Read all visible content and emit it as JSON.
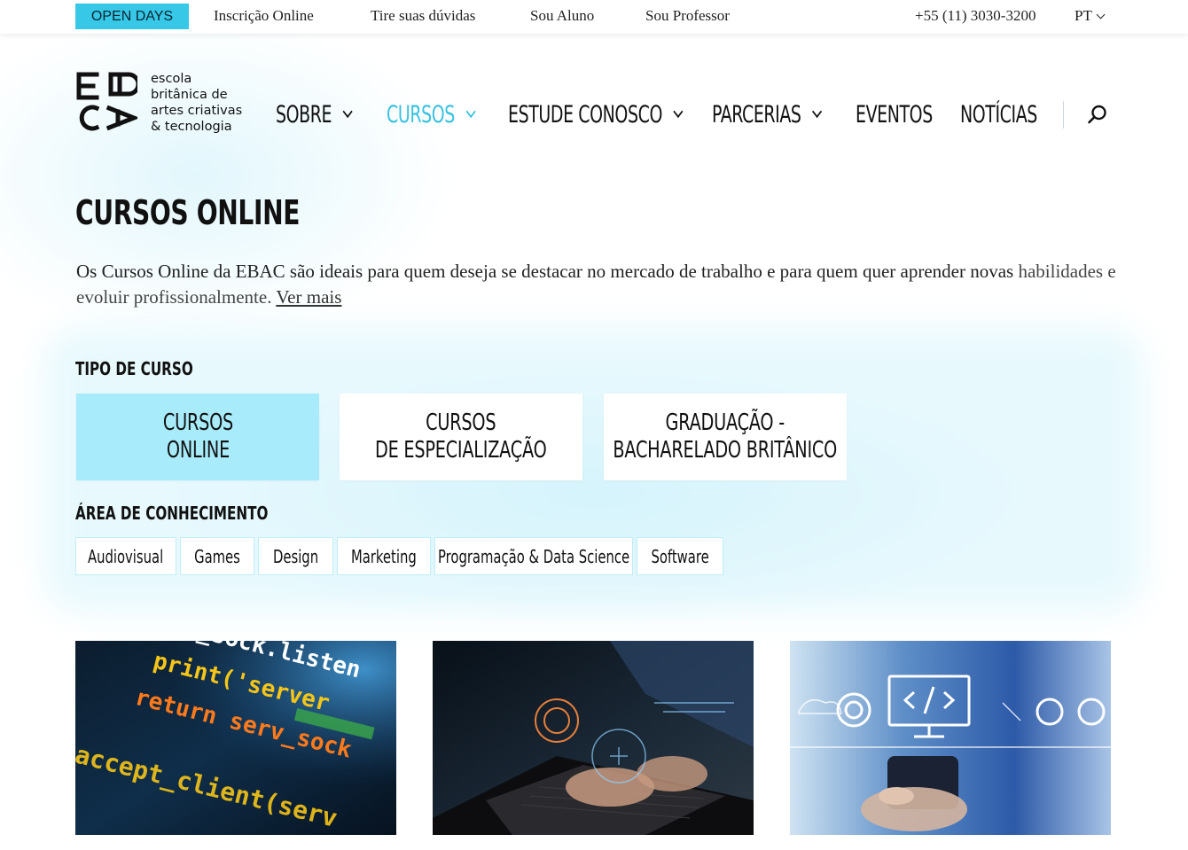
{
  "topbar": {
    "open_days": "OPEN DAYS",
    "links": [
      "Inscrição Online",
      "Tire suas dúvidas",
      "Sou Aluno",
      "Sou Professor"
    ],
    "phone": "+55 (11) 3030-3200",
    "language": "PT"
  },
  "logo": {
    "text": "escola\nbritânica de\nartes criativas\n& tecnologia"
  },
  "nav": {
    "items": [
      {
        "label": "SOBRE",
        "has_dropdown": true
      },
      {
        "label": "CURSOS",
        "has_dropdown": true,
        "active": true
      },
      {
        "label": "ESTUDE CONOSCO",
        "has_dropdown": true
      },
      {
        "label": "PARCERIAS",
        "has_dropdown": true
      },
      {
        "label": "EVENTOS",
        "has_dropdown": false
      },
      {
        "label": "NOTÍCIAS",
        "has_dropdown": false
      }
    ],
    "search_icon": "search-icon"
  },
  "page": {
    "title": "CURSOS ONLINE",
    "intro_line1": "Os Cursos Online da EBAC são ideais para quem deseja se destacar no mercado de trabalho e para quem quer aprender novas",
    "intro_line2": "habilidades e evoluir profissionalmente.",
    "see_more": "Ver mais"
  },
  "filters": {
    "type_label": "TIPO DE CURSO",
    "types": [
      {
        "label": "CURSOS\nONLINE",
        "selected": true
      },
      {
        "label": "CURSOS\nDE ESPECIALIZAÇÃO",
        "selected": false
      },
      {
        "label": "GRADUAÇÃO -\nBACHARELADO BRITÂNICO",
        "selected": false
      }
    ],
    "area_label": "ÁREA DE CONHECIMENTO",
    "areas": [
      "Audiovisual",
      "Games",
      "Design",
      "Marketing",
      "Programação & Data Science",
      "Software"
    ]
  },
  "courses": [
    {
      "image": "code-screen-photo",
      "code_text": [
        "v_sock.listen",
        "print('server",
        "return serv_sock",
        "accept_client(serv"
      ]
    },
    {
      "image": "laptop-hands-photo"
    },
    {
      "image": "tech-icons-phone-photo"
    }
  ],
  "colors": {
    "accent": "#36c1e0",
    "open_days_bg": "#36c8e6",
    "selected_card": "#a8ebfa",
    "chip_border": "#bfeef8"
  }
}
